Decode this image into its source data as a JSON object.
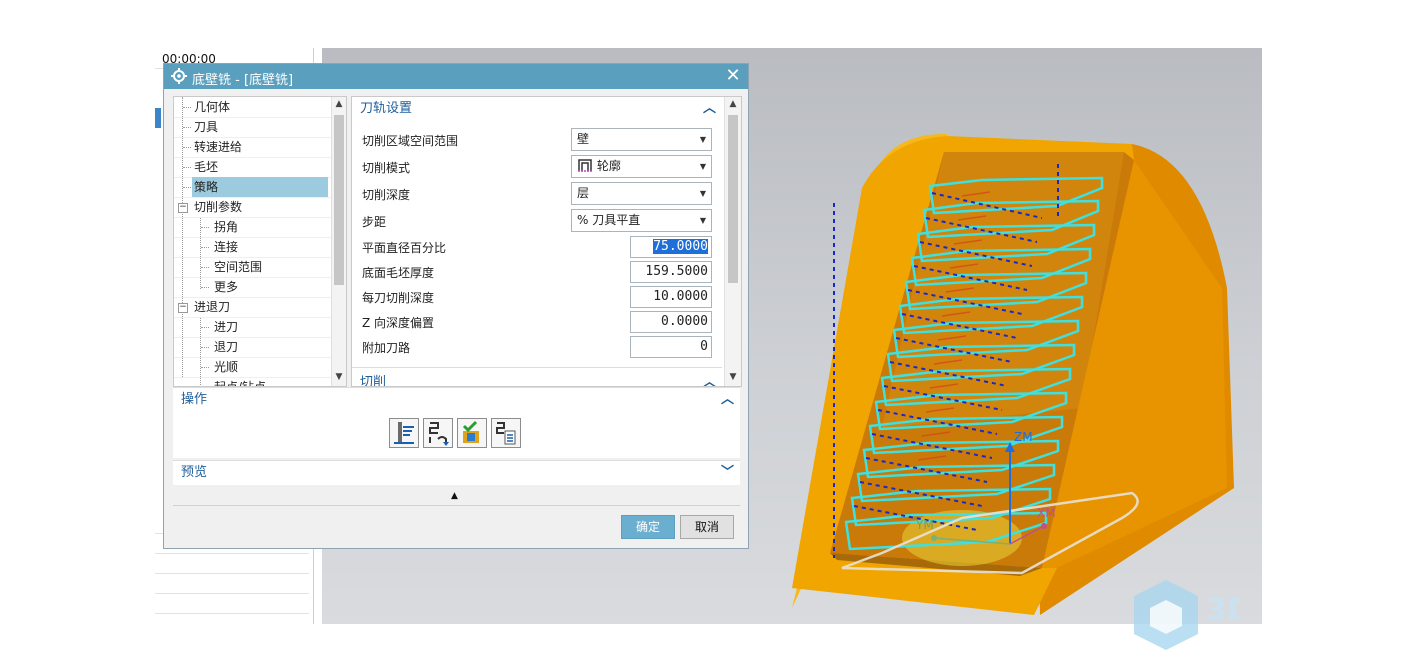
{
  "navigator": {
    "time": "00:00:00"
  },
  "dialog": {
    "title": "底壁铣 - [底壁铣]",
    "tree": [
      {
        "label": "几何体"
      },
      {
        "label": "刀具"
      },
      {
        "label": "转速进给"
      },
      {
        "label": "毛坯"
      },
      {
        "label": "策略",
        "selected": true
      },
      {
        "label": "切削参数",
        "expanded": true
      },
      {
        "label": "拐角"
      },
      {
        "label": "连接"
      },
      {
        "label": "空间范围"
      },
      {
        "label": "更多"
      },
      {
        "label": "进退刀",
        "expanded": true
      },
      {
        "label": "进刀"
      },
      {
        "label": "退刀"
      },
      {
        "label": "光顺"
      },
      {
        "label": "起点/钻点"
      }
    ],
    "path_settings": {
      "header": "刀轨设置",
      "rows": [
        {
          "label": "切削区域空间范围",
          "value": "壁",
          "type": "dropdown"
        },
        {
          "label": "切削模式",
          "value": "轮廓",
          "type": "dropdown",
          "icon": "profile-pattern-icon"
        },
        {
          "label": "切削深度",
          "value": "层",
          "type": "dropdown"
        },
        {
          "label": "步距",
          "value": "% 刀具平直",
          "type": "dropdown"
        },
        {
          "label": "平面直径百分比",
          "value": "75.0000",
          "type": "number",
          "highlighted": true
        },
        {
          "label": "底面毛坯厚度",
          "value": "159.5000",
          "type": "number"
        },
        {
          "label": "每刀切削深度",
          "value": "10.0000",
          "type": "number"
        },
        {
          "label": "Z 向深度偏置",
          "value": "0.0000",
          "type": "number"
        },
        {
          "label": "附加刀路",
          "value": "0",
          "type": "number"
        }
      ]
    },
    "cut_section": {
      "header": "切削"
    },
    "operation": {
      "header": "操作",
      "buttons": [
        "generate-icon",
        "replay-icon",
        "verify-icon",
        "list-icon"
      ]
    },
    "preview": {
      "header": "预览"
    },
    "ok_label": "确定",
    "cancel_label": "取消"
  },
  "viewport": {
    "axis_labels": {
      "z": "ZM",
      "y": "YM",
      "x": "XM"
    },
    "colors": {
      "part_front": "#f1a500",
      "part_side": "#e08a00",
      "part_rim": "#f6b81a",
      "toolpath": "#3ee0e0",
      "engage": "#1a28c8",
      "axis_z": "#1f6ee0"
    }
  },
  "watermark": {
    "text": "3D"
  }
}
